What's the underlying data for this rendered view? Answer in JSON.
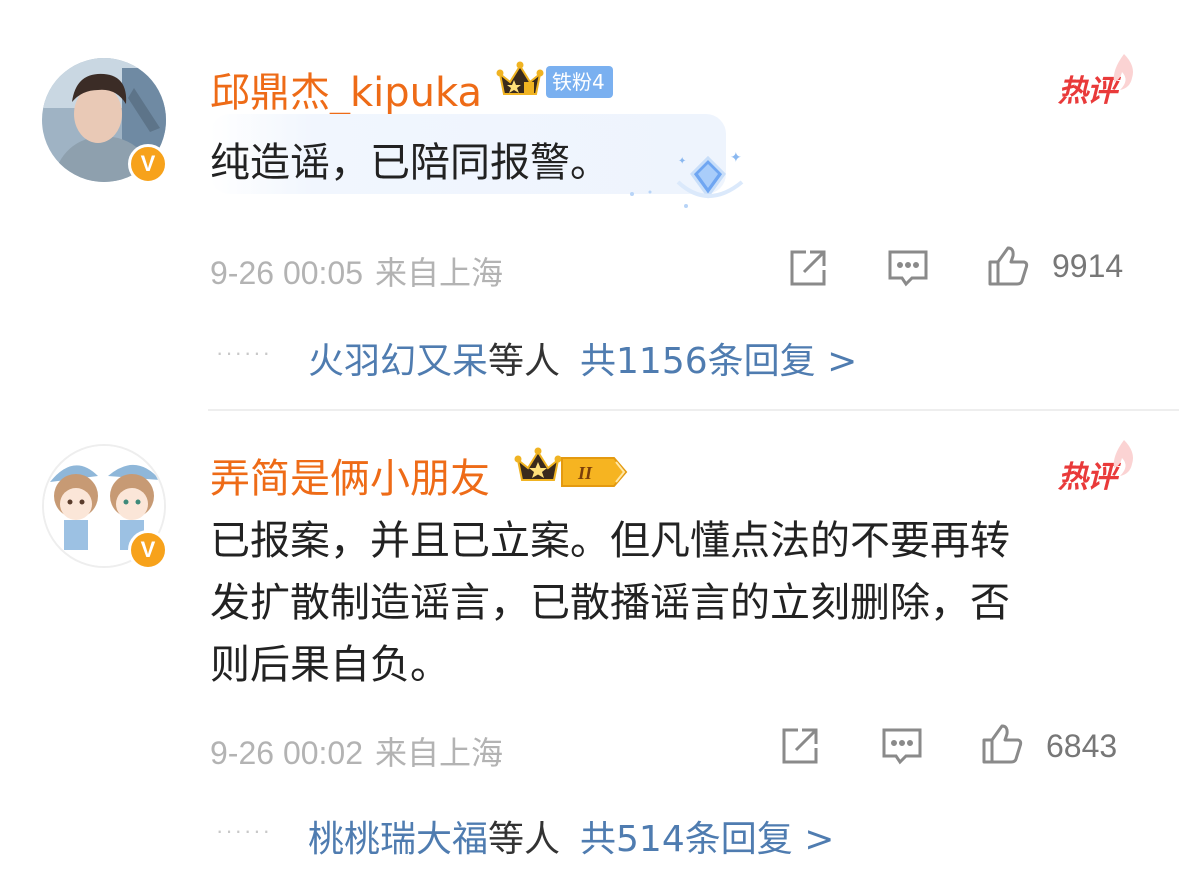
{
  "comments": [
    {
      "username": "邱鼎杰_kipuka",
      "fan_badge": "铁粉4",
      "hot_label": "热评",
      "text_lines": [
        "纯造谣，已陪同报警。"
      ],
      "time": "9-26 00:05",
      "location": "来自上海",
      "likes": "9914",
      "reply_names": "火羽幻又呆",
      "reply_etc": "等人",
      "reply_total": "共1156条回复 >",
      "dots": "······"
    },
    {
      "username": "弄简是俩小朋友",
      "level_badge": "II",
      "hot_label": "热评",
      "text_lines": [
        "已报案，并且已立案。但凡懂点法的不要再转",
        "发扩散制造谣言，已散播谣言的立刻删除，否",
        "则后果自负。"
      ],
      "time": "9-26 00:02",
      "location": "来自上海",
      "likes": "6843",
      "reply_names": "桃桃瑞大福",
      "reply_etc": "等人",
      "reply_total": "共514条回复 >",
      "dots": "······"
    }
  ],
  "icons": [
    "verified-v-icon",
    "crown-icon",
    "flame-icon",
    "diamond-icon",
    "share-icon",
    "reply-icon",
    "like-icon"
  ],
  "colors": {
    "username": "#ee6b17",
    "link": "#4f7cb0",
    "hot": "#e93a3a",
    "meta": "#b3b3b3",
    "verified": "#f7a21b"
  }
}
